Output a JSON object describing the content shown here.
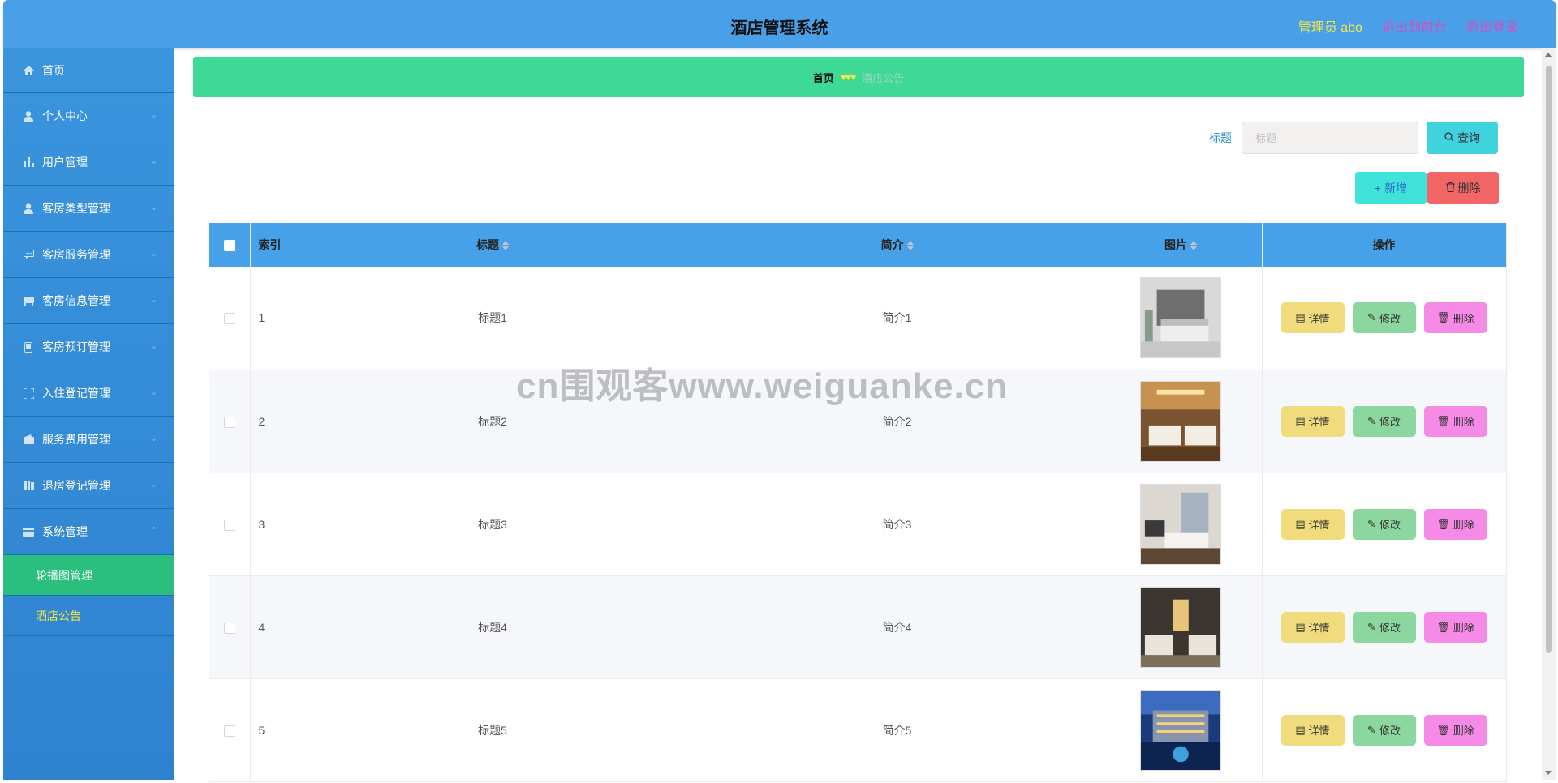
{
  "header": {
    "title": "酒店管理系统",
    "admin_label": "管理员 abo",
    "to_front": "退出到前台",
    "logout": "退出登录"
  },
  "sidebar": {
    "items": [
      {
        "label": "首页",
        "icon": "home-icon"
      },
      {
        "label": "个人中心",
        "icon": "user-icon"
      },
      {
        "label": "用户管理",
        "icon": "chart-icon"
      },
      {
        "label": "客房类型管理",
        "icon": "user-icon"
      },
      {
        "label": "客房服务管理",
        "icon": "chat-icon"
      },
      {
        "label": "客房信息管理",
        "icon": "bed-icon"
      },
      {
        "label": "客房预订管理",
        "icon": "phone-icon"
      },
      {
        "label": "入住登记管理",
        "icon": "frame-icon"
      },
      {
        "label": "服务费用管理",
        "icon": "wallet-icon"
      },
      {
        "label": "退房登记管理",
        "icon": "book-icon"
      },
      {
        "label": "系统管理",
        "icon": "card-icon"
      }
    ],
    "sub_items": [
      {
        "label": "轮播图管理"
      },
      {
        "label": "酒店公告"
      }
    ]
  },
  "breadcrumb": {
    "home": "首页",
    "separator": "♥♥♥",
    "current": "酒店公告"
  },
  "search": {
    "label": "标题",
    "placeholder": "标题",
    "value": "",
    "query_label": "查询"
  },
  "actions": {
    "add_label": "新增",
    "delete_label": "删除"
  },
  "table": {
    "headers": {
      "index": "索引",
      "title": "标题",
      "intro": "简介",
      "image": "图片",
      "ops": "操作"
    },
    "op_labels": {
      "detail": "详情",
      "edit": "修改",
      "remove": "删除"
    },
    "rows": [
      {
        "index": "1",
        "title": "标题1",
        "intro": "简介1"
      },
      {
        "index": "2",
        "title": "标题2",
        "intro": "简介2"
      },
      {
        "index": "3",
        "title": "标题3",
        "intro": "简介3"
      },
      {
        "index": "4",
        "title": "标题4",
        "intro": "简介4"
      },
      {
        "index": "5",
        "title": "标题5",
        "intro": "简介5"
      }
    ]
  },
  "watermark": "cn围观客www.weiguanke.cn",
  "colors": {
    "topbar": "#49a0e8",
    "sidebar": "#3a95dd",
    "sidebar_active": "#2bbf7e",
    "breadcrumb": "#3fd997",
    "table_header": "#47a1e8",
    "detail_btn": "#f0dc7c",
    "edit_btn": "#8cd6a0",
    "remove_btn": "#f58be6",
    "batch_delete": "#f16565",
    "add_btn": "#3fe3da"
  }
}
